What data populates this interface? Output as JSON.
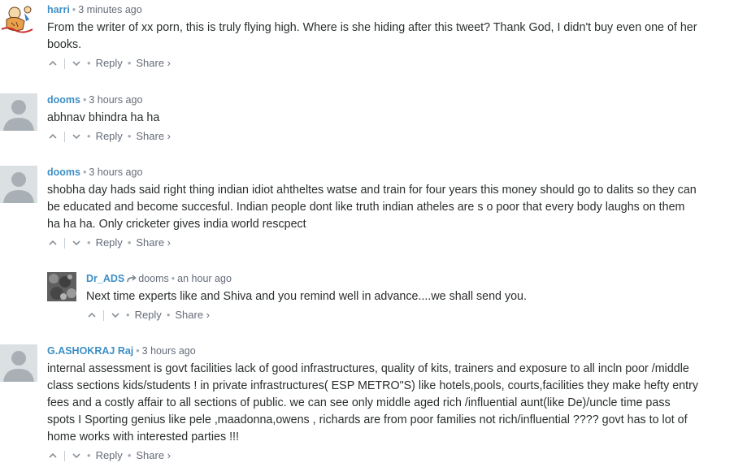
{
  "comments": [
    {
      "author": "harri",
      "time": "3 minutes ago",
      "text": "From the writer of xx porn, this is truly flying high. Where is she hiding after this tweet? Thank God, I didn't buy even one of her books.",
      "reply_label": "Reply",
      "share_label": "Share ›"
    },
    {
      "author": "dooms",
      "time": "3 hours ago",
      "text": "abhnav bhindra ha ha",
      "reply_label": "Reply",
      "share_label": "Share ›"
    },
    {
      "author": "dooms",
      "time": "3 hours ago",
      "text": "shobha day hads said right thing indian idiot ahtheltes watse and train for four years this money should go to dalits so they can be educated and become succesful. Indian people dont like truth indian atheles are s o poor that every body laughs on them ha ha ha. Only cricketer gives india world rescpect",
      "reply_label": "Reply",
      "share_label": "Share ›"
    },
    {
      "author": "Dr_ADS",
      "reply_to": "dooms",
      "time": "an hour ago",
      "text": "Next time experts like and Shiva and you remind well in advance....we shall send you.",
      "reply_label": "Reply",
      "share_label": "Share ›"
    },
    {
      "author": "G.ASHOKRAJ Raj",
      "time": "3 hours ago",
      "text": "internal assessment is govt facilities lack of good infrastructures, quality of kits, trainers and exposure to all incln poor /middle class sections kids/students ! in private infrastructures( ESP METRO\"S) like hotels,pools, courts,facilities they make hefty entry fees and a costly affair to all sections of public. we can see only middle aged rich /influential aunt(like De)/uncle time pass spots I Sporting genius like pele ,maadonna,owens , richards are from poor families not rich/influential ???? govt has to lot of home works with interested parties !!!",
      "reply_label": "Reply",
      "share_label": "Share ›"
    }
  ],
  "meta_separator": "•",
  "icons": {
    "upvote": "chevron-up-icon",
    "downvote": "chevron-down-icon",
    "reply_arrow": "reply-arrow-icon"
  },
  "colors": {
    "author": "#3d8fc6",
    "meta": "#656c7a",
    "text": "#2a2e2e",
    "avatar_bg": "#dbe0e3",
    "avatar_fg": "#a9b0b5"
  }
}
